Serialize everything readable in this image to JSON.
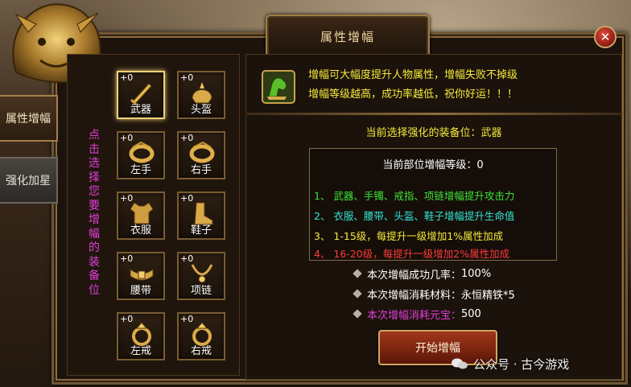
{
  "window": {
    "title": "属性增幅",
    "close_icon": "close-icon"
  },
  "tabs": [
    {
      "label": "属性增幅",
      "active": true
    },
    {
      "label": "强化加星",
      "active": false
    }
  ],
  "hint_vertical": "点击选择您要增幅的装备位",
  "slots": [
    {
      "level": "+0",
      "name": "武器",
      "icon": "weapon-icon",
      "selected": true
    },
    {
      "level": "+0",
      "name": "头盔",
      "icon": "helmet-icon"
    },
    {
      "level": "+0",
      "name": "左手",
      "icon": "left-bracelet-icon"
    },
    {
      "level": "+0",
      "name": "右手",
      "icon": "right-bracelet-icon"
    },
    {
      "level": "+0",
      "name": "衣服",
      "icon": "armor-icon"
    },
    {
      "level": "+0",
      "name": "鞋子",
      "icon": "boots-icon"
    },
    {
      "level": "+0",
      "name": "腰带",
      "icon": "belt-icon"
    },
    {
      "level": "+0",
      "name": "项链",
      "icon": "necklace-icon"
    },
    {
      "level": "+0",
      "name": "左戒",
      "icon": "left-ring-icon"
    },
    {
      "level": "+0",
      "name": "右戒",
      "icon": "right-ring-icon"
    }
  ],
  "intro": {
    "icon": "strength-arm-icon",
    "line1": "增幅可大幅度提升人物属性，增幅失败不掉级",
    "line2": "增幅等级越高，成功率越低，祝你好运！！！"
  },
  "selected_slot_text": "当前选择强化的装备位：武器",
  "level_text": "当前部位增幅等级：0",
  "rules": [
    {
      "text": "1、 武器、手镯、戒指、项链增幅提升攻击力",
      "color": "#3fe03a"
    },
    {
      "text": "2、 衣服、腰带、头盔、鞋子增幅提升生命值",
      "color": "#34e3d6"
    },
    {
      "text": "3、 1-15级，每提升一级增加1%属性加成",
      "color": "#f6ea3c"
    },
    {
      "text": "4、 16-20级，每提升一级增加2%属性加成",
      "color": "#ff3a3a"
    }
  ],
  "stats": [
    {
      "label": "本次增幅成功几率：",
      "value": "100%",
      "label_color": "#ffffff",
      "value_color": "#ffffff"
    },
    {
      "label": "本次增幅消耗材料：",
      "value": "永恒精铁*5",
      "label_color": "#ffffff",
      "value_color": "#ffffff"
    },
    {
      "label": "本次增幅消耗元宝：",
      "value": "500",
      "label_color": "#e03fd9",
      "value_color": "#ffffff"
    }
  ],
  "start_button": "开始增幅",
  "watermark": "公众号 · 古今游戏",
  "colors": {
    "gold_text": "#f6ea3c",
    "pink_hint": "#e33fd6",
    "frame_gold": "#a07d45"
  }
}
